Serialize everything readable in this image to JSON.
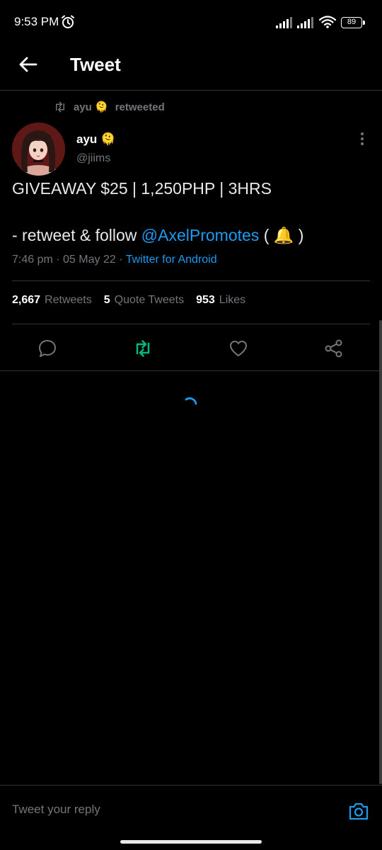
{
  "status_bar": {
    "time": "9:53 PM",
    "battery": "89"
  },
  "header": {
    "title": "Tweet"
  },
  "retweet_context": {
    "name": "ayu",
    "emoji": "🫠",
    "label": "retweeted"
  },
  "tweet": {
    "author": {
      "name": "ayu",
      "emoji": "🫠",
      "handle": "@jiims"
    },
    "line1": "GIVEAWAY $25 | 1,250PHP | 3HRS",
    "line2_prefix": "- retweet & follow ",
    "mention": "@AxelPromotes",
    "line2_open": " ( ",
    "line2_emoji": "🔔",
    "line2_close": " )",
    "time": "7:46 pm",
    "date": "05 May 22",
    "separator": " · ",
    "source": "Twitter for Android"
  },
  "stats": {
    "retweets_count": "2,667",
    "retweets_label": "Retweets",
    "quotes_count": "5",
    "quotes_label": "Quote Tweets",
    "likes_count": "953",
    "likes_label": "Likes"
  },
  "actions": {
    "reply_icon": "comment-icon",
    "retweet_icon": "retweet-icon",
    "like_icon": "heart-icon",
    "share_icon": "share-icon"
  },
  "reply_bar": {
    "placeholder": "Tweet your reply"
  },
  "colors": {
    "accent": "#1d9bf0",
    "retweet_active": "#00ba7c",
    "muted": "#71767b",
    "background": "#000000"
  }
}
